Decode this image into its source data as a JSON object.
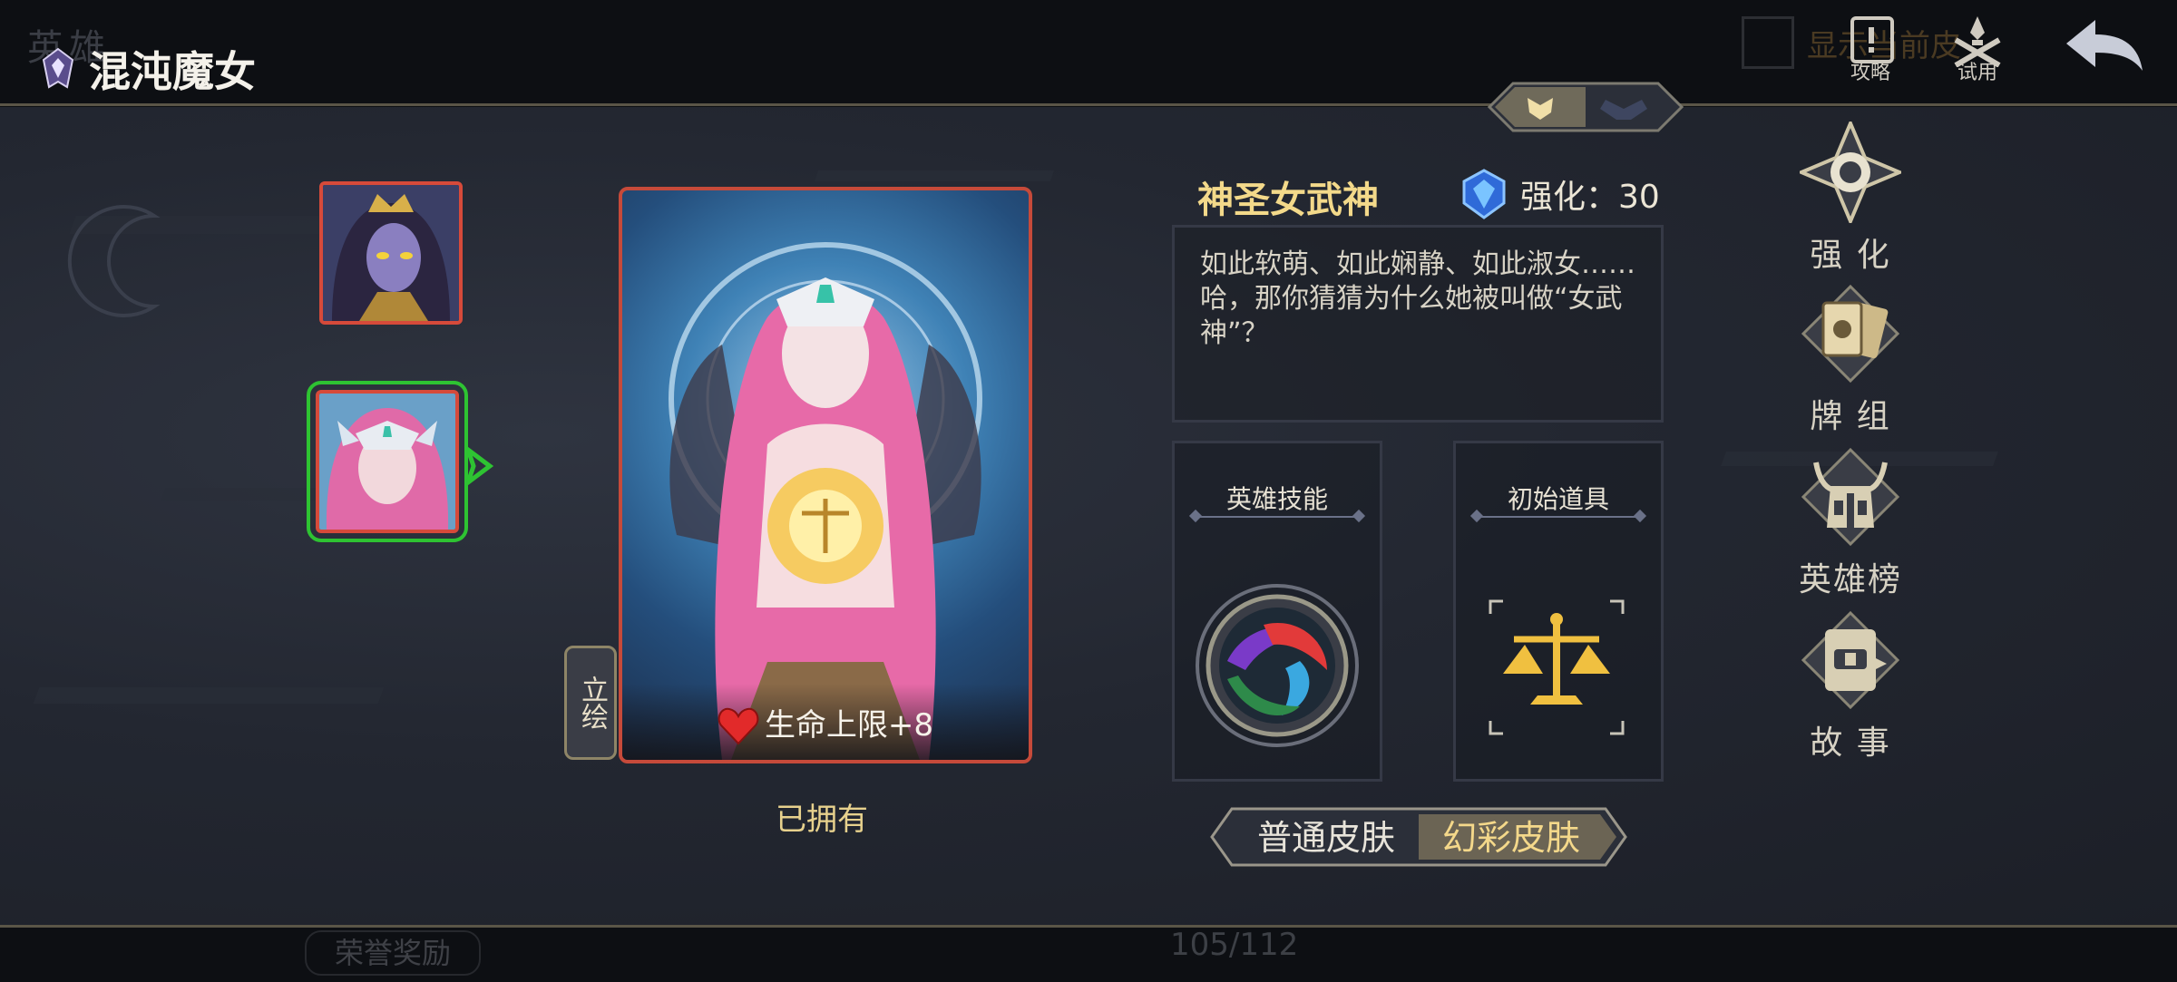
{
  "header": {
    "title": "混沌魔女",
    "ghost_tab_text": "英雄",
    "ghost_filter_text": "显示当前皮",
    "strategy_label": "攻略",
    "trial_label": "试用"
  },
  "card": {
    "bonus_text": "生命上限+8",
    "view_art_label": "立绘",
    "status": "已拥有"
  },
  "skin": {
    "name": "神圣女武神",
    "enhance_text": "强化：30",
    "description": "如此软萌、如此娴静、如此淑女……哈，那你猜猜为什么她被叫做“女武神”？",
    "skill_title": "英雄技能",
    "item_title": "初始道具"
  },
  "skin_toggle": {
    "normal_label": "普通皮肤",
    "fancy_label": "幻彩皮肤",
    "selected": "幻彩皮肤"
  },
  "menu": {
    "enhance": "强 化",
    "deck": "牌 组",
    "ranking": "英雄榜",
    "story": "故 事"
  },
  "footer": {
    "honor_label": "荣誉奖励",
    "pager": "105/112"
  },
  "colors": {
    "accent_gold": "#f3d98a",
    "selected_green": "#2ec332",
    "card_border_red": "#d64a3a",
    "panel_bg": "#1c1f27"
  },
  "icons": [
    "faction-icon",
    "strategy-icon",
    "trial-icon",
    "back-arrow-icon",
    "heart-icon",
    "enhance-gem-icon",
    "skill-orb-icon",
    "scales-icon",
    "enhance-star-icon",
    "deck-cards-icon",
    "ranking-helmet-icon",
    "story-book-icon"
  ]
}
